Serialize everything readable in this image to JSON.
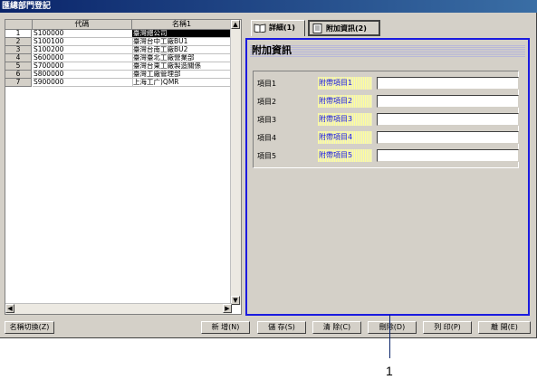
{
  "window": {
    "title": "匯總部門登記"
  },
  "grid": {
    "columns": [
      "代碼",
      "名稱1"
    ],
    "rows": [
      {
        "num": "1",
        "code": "S100000",
        "name": "臺灣總公司"
      },
      {
        "num": "2",
        "code": "S100100",
        "name": "臺灣台中工廠BU1"
      },
      {
        "num": "3",
        "code": "S100200",
        "name": "臺灣台南工廠BU2"
      },
      {
        "num": "4",
        "code": "S600000",
        "name": "臺灣臺北工廠營業部"
      },
      {
        "num": "5",
        "code": "S700000",
        "name": "臺灣台東工廠製造關係"
      },
      {
        "num": "6",
        "code": "S800000",
        "name": "臺灣工廠管理部"
      },
      {
        "num": "7",
        "code": "S900000",
        "name": "上海工广)QMR"
      }
    ]
  },
  "tabs": [
    {
      "label": "詳細(1)",
      "icon": "book-icon"
    },
    {
      "label": "附加資訊(2)",
      "icon": "document-icon"
    }
  ],
  "panel": {
    "title": "附加資訊",
    "fields": [
      {
        "label": "項目1",
        "name": "附帶項目1",
        "value": ""
      },
      {
        "label": "項目2",
        "name": "附帶項目2",
        "value": ""
      },
      {
        "label": "項目3",
        "name": "附帶項目3",
        "value": ""
      },
      {
        "label": "項目4",
        "name": "附帶項目4",
        "value": ""
      },
      {
        "label": "項目5",
        "name": "附帶項目5",
        "value": ""
      }
    ]
  },
  "buttons": {
    "name_switch": "名稱切換(Z)",
    "add": "新 增(N)",
    "save": "儲 存(S)",
    "clear": "清 除(C)",
    "delete": "刪除(D)",
    "print": "列 印(P)",
    "close": "離 開(E)"
  },
  "callout": {
    "number": "1"
  },
  "colors": {
    "accent": "#1a1ae0",
    "titlebar": "#0a246a"
  }
}
